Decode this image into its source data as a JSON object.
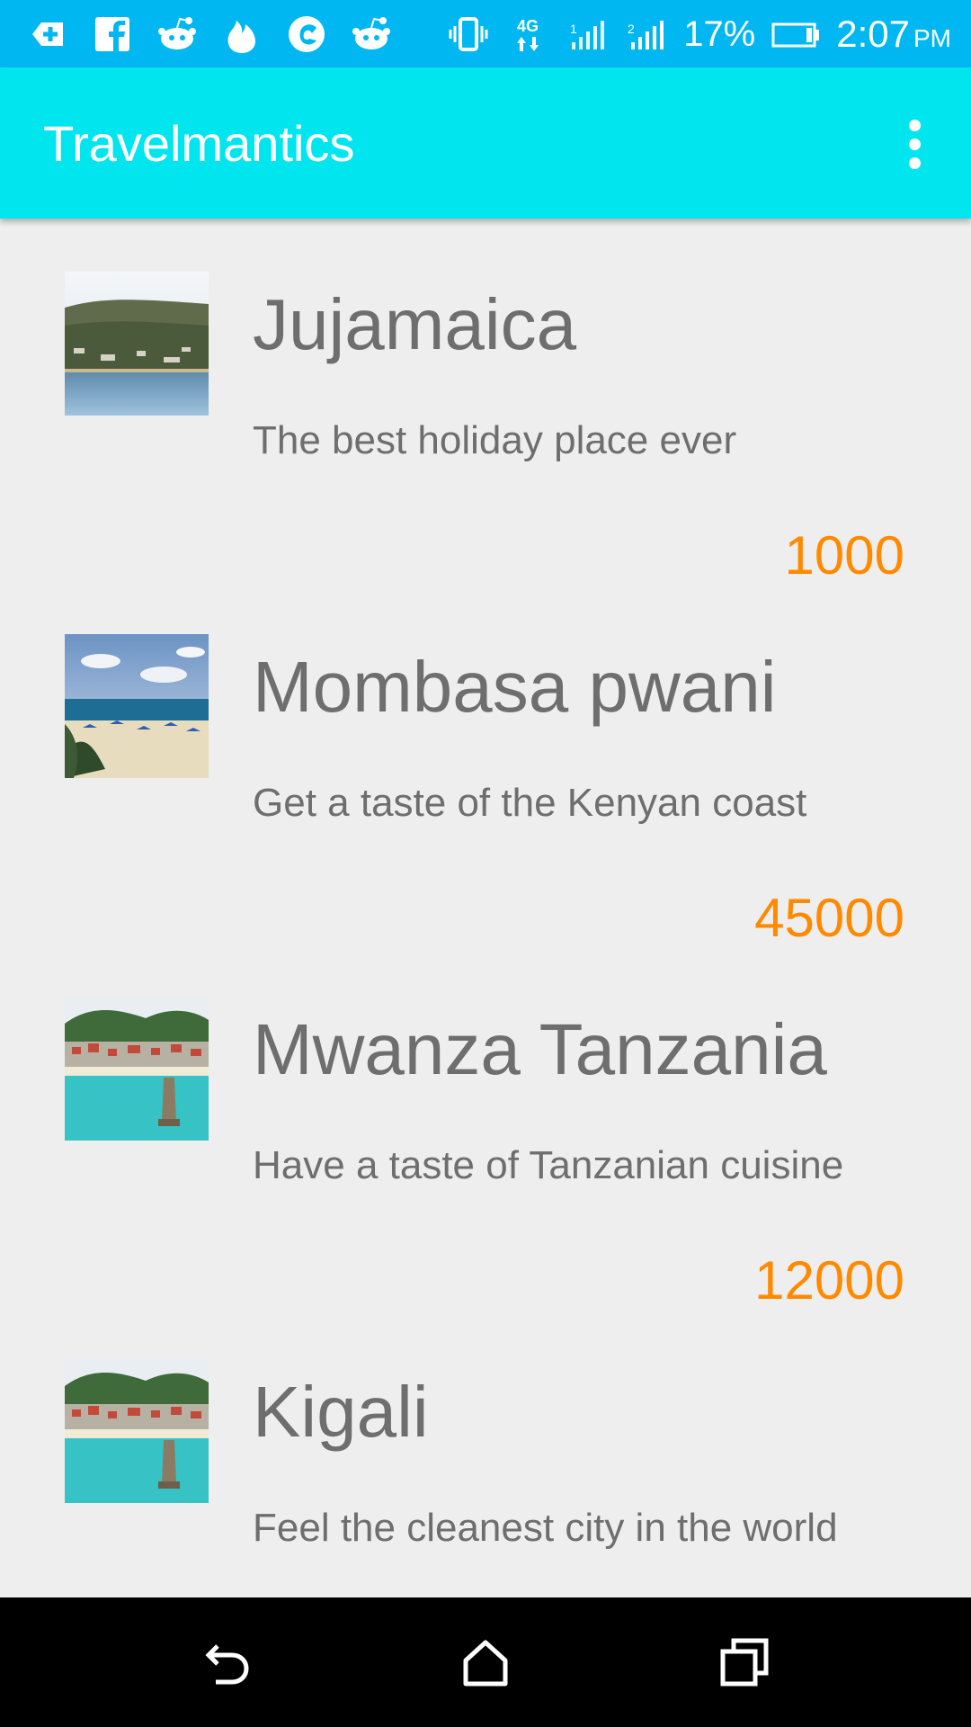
{
  "status_bar": {
    "icons": [
      "add-icon",
      "facebook-icon",
      "reddit-icon",
      "tinder-icon",
      "opera-icon",
      "reddit-icon"
    ],
    "network": "4G",
    "battery": "17%",
    "time": "2:07",
    "ampm": "PM"
  },
  "app_bar": {
    "title": "Travelmantics",
    "menu_icon": "overflow-menu-icon"
  },
  "deals": [
    {
      "title": "Jujamaica",
      "description": "The best holiday place ever",
      "price": "1000",
      "image": "resort-hillside-image"
    },
    {
      "title": "Mombasa pwani",
      "description": "Get a taste of the Kenyan coast",
      "price": "45000",
      "image": "beach-umbrellas-image"
    },
    {
      "title": "Mwanza Tanzania",
      "description": "Have a taste of Tanzanian cuisine",
      "price": "12000",
      "image": "harbor-town-image"
    },
    {
      "title": "Kigali",
      "description": "Feel the cleanest city in the world",
      "price": "",
      "image": "harbor-town-image"
    }
  ],
  "nav_bar": {
    "icons": [
      "back-icon",
      "home-icon",
      "recents-icon"
    ]
  },
  "colors": {
    "status_bar": "#00b7f1",
    "app_bar": "#00e5ee",
    "price": "#ff8a00",
    "text": "#6e6e6e",
    "background": "#eeeeee"
  }
}
